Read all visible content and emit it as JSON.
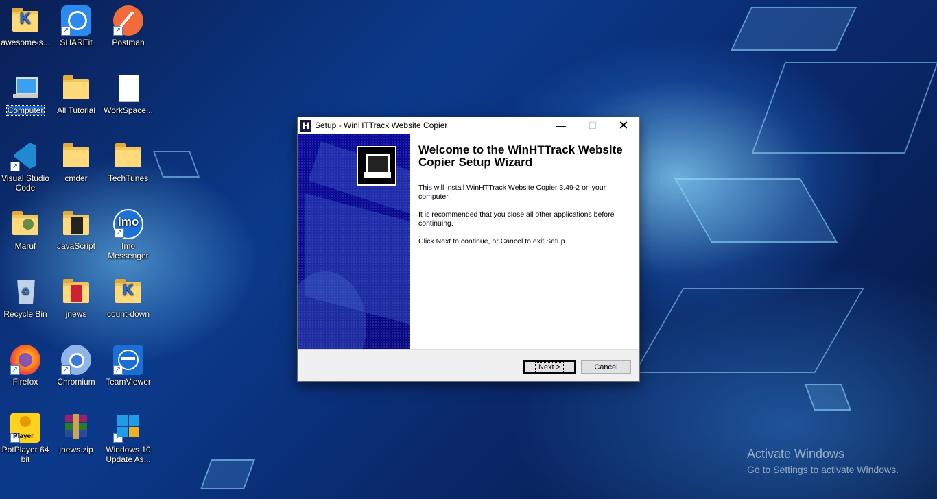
{
  "desktop": {
    "icons": [
      {
        "label": "awesome-s..."
      },
      {
        "label": "SHAREit"
      },
      {
        "label": "Postman"
      },
      {
        "label": "Computer"
      },
      {
        "label": "All Tutorial"
      },
      {
        "label": "WorkSpace..."
      },
      {
        "label": "Visual Studio Code"
      },
      {
        "label": "cmder"
      },
      {
        "label": "TechTunes"
      },
      {
        "label": "Maruf"
      },
      {
        "label": "JavaScript"
      },
      {
        "label": "Imo Messenger"
      },
      {
        "label": "Recycle Bin"
      },
      {
        "label": "jnews"
      },
      {
        "label": "count-down"
      },
      {
        "label": "Firefox"
      },
      {
        "label": "Chromium"
      },
      {
        "label": "TeamViewer"
      },
      {
        "label": "PotPlayer 64 bit"
      },
      {
        "label": "jnews.zip"
      },
      {
        "label": "Windows 10 Update As..."
      }
    ],
    "icon_glyphs": {
      "imo": "imo",
      "potplayer": "Player",
      "shortcut_arrow": "↗"
    }
  },
  "watermark": {
    "line1": "Activate Windows",
    "line2": "Go to Settings to activate Windows."
  },
  "dialog": {
    "title": "Setup - WinHTTrack Website Copier",
    "app_icon_letter": "H",
    "controls": {
      "minimize": "—",
      "maximize": "☐",
      "close": "✕"
    },
    "heading": "Welcome to the WinHTTrack Website Copier Setup Wizard",
    "paragraphs": [
      "This will install WinHTTrack Website Copier 3.49-2 on your computer.",
      "It is recommended that you close all other applications before continuing.",
      "Click Next to continue, or Cancel to exit Setup."
    ],
    "buttons": {
      "next": "Next >",
      "cancel": "Cancel"
    }
  },
  "colors": {
    "sidebar": "#0b0b9c",
    "selection": "#1e63c6",
    "desktop_dark": "#0a1f55"
  }
}
